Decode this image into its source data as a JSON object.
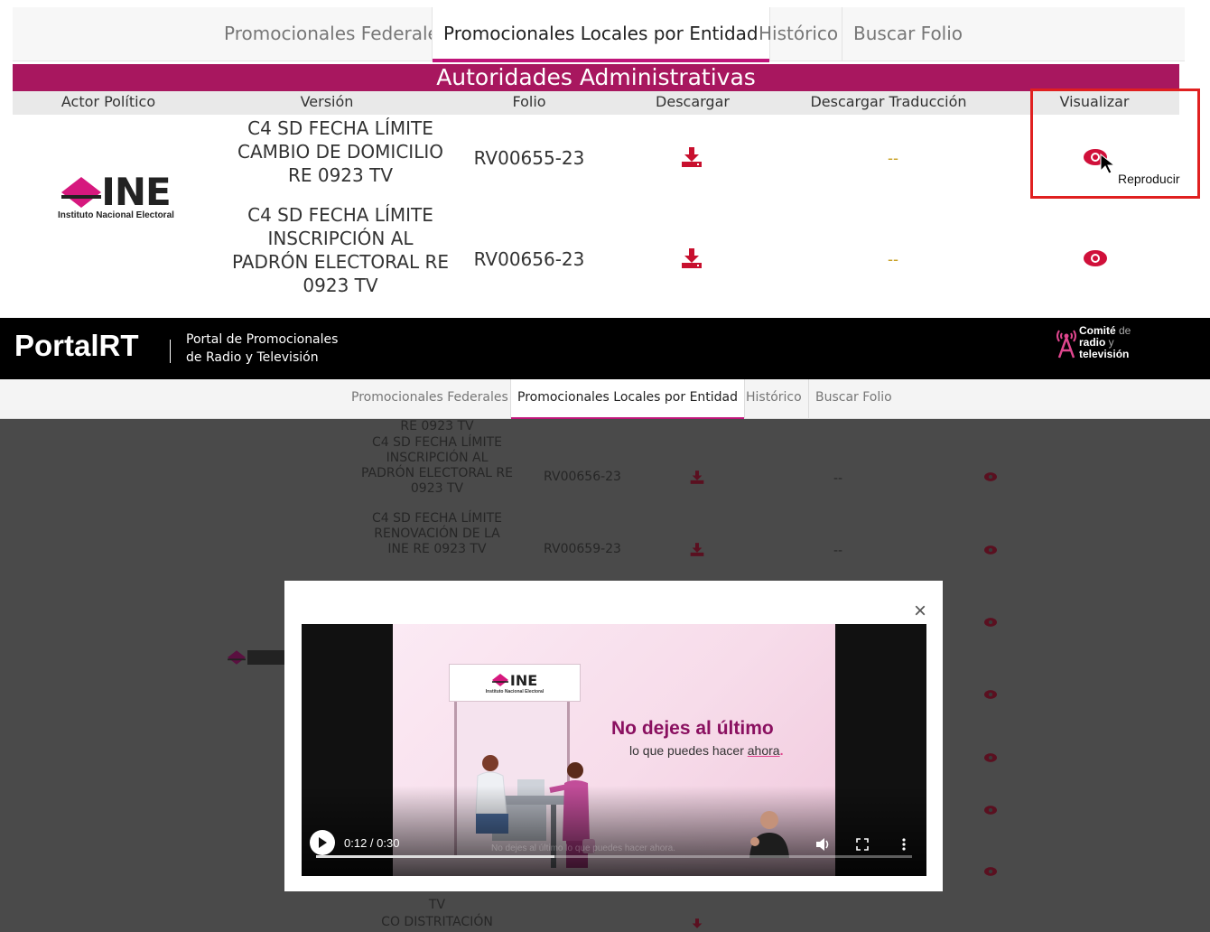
{
  "zoom_panel": {
    "tabs": [
      "Promocionales Federales",
      "Promocionales Locales por Entidad",
      "Histórico",
      "Buscar Folio"
    ],
    "active_tab": "Promocionales Locales por Entidad",
    "section_title": "Autoridades Administrativas",
    "columns": [
      "Actor Político",
      "Versión",
      "Folio",
      "Descargar",
      "Descargar Traducción",
      "Visualizar"
    ],
    "rows": [
      {
        "version_lines": [
          "C4 SD FECHA LÍMITE",
          "CAMBIO DE DOMICILIO",
          "RE 0923 TV"
        ],
        "folio": "RV00655-23",
        "translation": "--"
      },
      {
        "version_lines": [
          "C4 SD FECHA LÍMITE",
          "INSCRIPCIÓN AL",
          "PADRÓN ELECTORAL RE",
          "0923 TV"
        ],
        "folio": "RV00656-23",
        "translation": "--"
      }
    ],
    "logo": {
      "text": "INE",
      "subtitle": "Instituto Nacional Electoral"
    },
    "cursor_tooltip": "Reproducir"
  },
  "portal": {
    "logo": "PortalRT",
    "subtitle_line1": "Portal de Promocionales",
    "subtitle_line2": "de Radio y Televisión",
    "committee": {
      "line1_bold": "Comité",
      "line1_rest": " de",
      "line2_bold": "radio",
      "line2_rest": " y",
      "line3": "televisión"
    },
    "tabs": [
      "Promocionales Federales",
      "Promocionales Locales por Entidad",
      "Histórico",
      "Buscar Folio"
    ],
    "active_tab": "Promocionales Locales por Entidad"
  },
  "background_list": {
    "fragment_top": "RE 0923 TV",
    "rows": [
      {
        "version_lines": [
          "C4 SD FECHA LÍMITE",
          "INSCRIPCIÓN AL",
          "PADRÓN ELECTORAL RE",
          "0923 TV"
        ],
        "folio": "RV00656-23",
        "translation": "--"
      },
      {
        "version_lines": [
          "C4 SD FECHA LÍMITE",
          "RENOVACIÓN DE LA",
          "INE RE 0923 TV"
        ],
        "folio": "RV00659-23",
        "translation": "--"
      }
    ],
    "bottom_fragment_1": "TV",
    "bottom_fragment_2": "CO DISTRITACIÓN"
  },
  "video_modal": {
    "close_symbol": "×",
    "frame": {
      "logo_text": "INE",
      "logo_subtitle": "Instituto Nacional Electoral",
      "headline": "No dejes al último",
      "tagline_start": "lo que puedes hacer ",
      "tagline_word": "ahora",
      "tagline_end": ".",
      "caption_ghost": "No dejes al último lo que puedes hacer ahora."
    },
    "player": {
      "current_time": "0:12",
      "duration": "0:30",
      "time_label": "0:12 / 0:30",
      "progress_fraction": 0.4
    }
  },
  "colors": {
    "brand_magenta": "#c0157a",
    "band": "#a8175f",
    "download_icon": "#c8102e",
    "eye_icon": "#d0103a",
    "dash": "#c9a227",
    "highlight_box": "#e02020"
  },
  "icons": {
    "download": "download-icon",
    "visualize": "eye-icon",
    "close": "close-icon",
    "play": "play-icon",
    "volume": "volume-icon",
    "fullscreen": "fullscreen-icon",
    "more": "more-options-icon",
    "cursor": "mouse-pointer-icon"
  }
}
